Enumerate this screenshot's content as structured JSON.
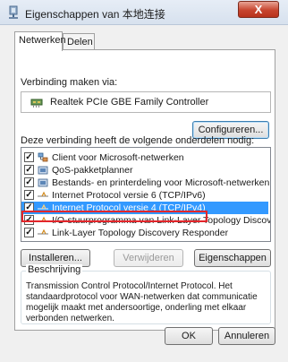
{
  "window": {
    "title": "Eigenschappen van 本地连接",
    "close_label": "X"
  },
  "tabs": [
    {
      "label": "Netwerken",
      "active": true
    },
    {
      "label": "Delen",
      "active": false
    }
  ],
  "connection": {
    "label": "Verbinding maken via:",
    "adapter_name": "Realtek PCIe GBE Family Controller",
    "adapter_icon": "network-adapter-icon",
    "configure_label": "Configureren..."
  },
  "components": {
    "label": "Deze verbinding heeft de volgende onderdelen nodig:",
    "items": [
      {
        "label": "Client voor Microsoft-netwerken",
        "checked": true,
        "icon": "client-icon"
      },
      {
        "label": "QoS-pakketplanner",
        "checked": true,
        "icon": "qos-icon"
      },
      {
        "label": "Bestands- en printerdeling voor Microsoft-netwerken",
        "checked": true,
        "icon": "file-print-sharing-icon"
      },
      {
        "label": "Internet Protocol versie 6 (TCP/IPv6)",
        "checked": true,
        "icon": "protocol-icon"
      },
      {
        "label": "Internet Protocol versie 4 (TCP/IPv4)",
        "checked": true,
        "icon": "protocol-icon",
        "selected": true
      },
      {
        "label": "I/O-stuurprogramma van Link-Layer Topology Discovery...",
        "checked": true,
        "icon": "protocol-icon"
      },
      {
        "label": "Link-Layer Topology Discovery Responder",
        "checked": true,
        "icon": "protocol-icon"
      }
    ]
  },
  "actions": {
    "install_label": "Installeren...",
    "remove_label": "Verwijderen",
    "properties_label": "Eigenschappen"
  },
  "description": {
    "legend": "Beschrijving",
    "lines": [
      "Transmission Control Protocol/Internet Protocol. Het",
      "standaardprotocol voor WAN-netwerken dat communicatie",
      "mogelijk maakt met andersoortige, onderling met elkaar",
      "verbonden netwerken."
    ]
  },
  "footer": {
    "ok_label": "OK",
    "cancel_label": "Annuleren"
  },
  "colors": {
    "selection": "#3399ff",
    "highlight_border": "#e3262b",
    "close_button": "#c7452f"
  }
}
